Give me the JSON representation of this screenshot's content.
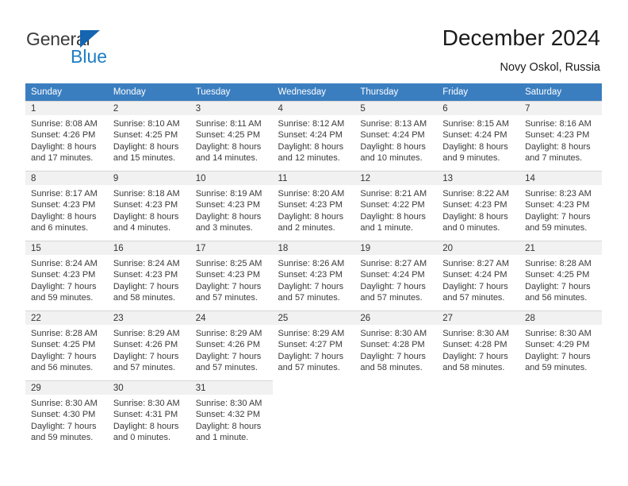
{
  "brand": {
    "name_top": "General",
    "name_bottom": "Blue",
    "triangle_color": "#1565b0",
    "text_color": "#3b3b3b",
    "blue_color": "#1f7ec4"
  },
  "header": {
    "title": "December 2024",
    "location": "Novy Oskol, Russia"
  },
  "theme": {
    "header_row_bg": "#3b7ec0",
    "header_row_text": "#ffffff",
    "daynum_bg": "#f1f1f1",
    "cell_text": "#3a3a3a"
  },
  "weekdays": [
    "Sunday",
    "Monday",
    "Tuesday",
    "Wednesday",
    "Thursday",
    "Friday",
    "Saturday"
  ],
  "weeks": [
    [
      {
        "day": "1",
        "sunrise": "Sunrise: 8:08 AM",
        "sunset": "Sunset: 4:26 PM",
        "daylight1": "Daylight: 8 hours",
        "daylight2": "and 17 minutes."
      },
      {
        "day": "2",
        "sunrise": "Sunrise: 8:10 AM",
        "sunset": "Sunset: 4:25 PM",
        "daylight1": "Daylight: 8 hours",
        "daylight2": "and 15 minutes."
      },
      {
        "day": "3",
        "sunrise": "Sunrise: 8:11 AM",
        "sunset": "Sunset: 4:25 PM",
        "daylight1": "Daylight: 8 hours",
        "daylight2": "and 14 minutes."
      },
      {
        "day": "4",
        "sunrise": "Sunrise: 8:12 AM",
        "sunset": "Sunset: 4:24 PM",
        "daylight1": "Daylight: 8 hours",
        "daylight2": "and 12 minutes."
      },
      {
        "day": "5",
        "sunrise": "Sunrise: 8:13 AM",
        "sunset": "Sunset: 4:24 PM",
        "daylight1": "Daylight: 8 hours",
        "daylight2": "and 10 minutes."
      },
      {
        "day": "6",
        "sunrise": "Sunrise: 8:15 AM",
        "sunset": "Sunset: 4:24 PM",
        "daylight1": "Daylight: 8 hours",
        "daylight2": "and 9 minutes."
      },
      {
        "day": "7",
        "sunrise": "Sunrise: 8:16 AM",
        "sunset": "Sunset: 4:23 PM",
        "daylight1": "Daylight: 8 hours",
        "daylight2": "and 7 minutes."
      }
    ],
    [
      {
        "day": "8",
        "sunrise": "Sunrise: 8:17 AM",
        "sunset": "Sunset: 4:23 PM",
        "daylight1": "Daylight: 8 hours",
        "daylight2": "and 6 minutes."
      },
      {
        "day": "9",
        "sunrise": "Sunrise: 8:18 AM",
        "sunset": "Sunset: 4:23 PM",
        "daylight1": "Daylight: 8 hours",
        "daylight2": "and 4 minutes."
      },
      {
        "day": "10",
        "sunrise": "Sunrise: 8:19 AM",
        "sunset": "Sunset: 4:23 PM",
        "daylight1": "Daylight: 8 hours",
        "daylight2": "and 3 minutes."
      },
      {
        "day": "11",
        "sunrise": "Sunrise: 8:20 AM",
        "sunset": "Sunset: 4:23 PM",
        "daylight1": "Daylight: 8 hours",
        "daylight2": "and 2 minutes."
      },
      {
        "day": "12",
        "sunrise": "Sunrise: 8:21 AM",
        "sunset": "Sunset: 4:22 PM",
        "daylight1": "Daylight: 8 hours",
        "daylight2": "and 1 minute."
      },
      {
        "day": "13",
        "sunrise": "Sunrise: 8:22 AM",
        "sunset": "Sunset: 4:23 PM",
        "daylight1": "Daylight: 8 hours",
        "daylight2": "and 0 minutes."
      },
      {
        "day": "14",
        "sunrise": "Sunrise: 8:23 AM",
        "sunset": "Sunset: 4:23 PM",
        "daylight1": "Daylight: 7 hours",
        "daylight2": "and 59 minutes."
      }
    ],
    [
      {
        "day": "15",
        "sunrise": "Sunrise: 8:24 AM",
        "sunset": "Sunset: 4:23 PM",
        "daylight1": "Daylight: 7 hours",
        "daylight2": "and 59 minutes."
      },
      {
        "day": "16",
        "sunrise": "Sunrise: 8:24 AM",
        "sunset": "Sunset: 4:23 PM",
        "daylight1": "Daylight: 7 hours",
        "daylight2": "and 58 minutes."
      },
      {
        "day": "17",
        "sunrise": "Sunrise: 8:25 AM",
        "sunset": "Sunset: 4:23 PM",
        "daylight1": "Daylight: 7 hours",
        "daylight2": "and 57 minutes."
      },
      {
        "day": "18",
        "sunrise": "Sunrise: 8:26 AM",
        "sunset": "Sunset: 4:23 PM",
        "daylight1": "Daylight: 7 hours",
        "daylight2": "and 57 minutes."
      },
      {
        "day": "19",
        "sunrise": "Sunrise: 8:27 AM",
        "sunset": "Sunset: 4:24 PM",
        "daylight1": "Daylight: 7 hours",
        "daylight2": "and 57 minutes."
      },
      {
        "day": "20",
        "sunrise": "Sunrise: 8:27 AM",
        "sunset": "Sunset: 4:24 PM",
        "daylight1": "Daylight: 7 hours",
        "daylight2": "and 57 minutes."
      },
      {
        "day": "21",
        "sunrise": "Sunrise: 8:28 AM",
        "sunset": "Sunset: 4:25 PM",
        "daylight1": "Daylight: 7 hours",
        "daylight2": "and 56 minutes."
      }
    ],
    [
      {
        "day": "22",
        "sunrise": "Sunrise: 8:28 AM",
        "sunset": "Sunset: 4:25 PM",
        "daylight1": "Daylight: 7 hours",
        "daylight2": "and 56 minutes."
      },
      {
        "day": "23",
        "sunrise": "Sunrise: 8:29 AM",
        "sunset": "Sunset: 4:26 PM",
        "daylight1": "Daylight: 7 hours",
        "daylight2": "and 57 minutes."
      },
      {
        "day": "24",
        "sunrise": "Sunrise: 8:29 AM",
        "sunset": "Sunset: 4:26 PM",
        "daylight1": "Daylight: 7 hours",
        "daylight2": "and 57 minutes."
      },
      {
        "day": "25",
        "sunrise": "Sunrise: 8:29 AM",
        "sunset": "Sunset: 4:27 PM",
        "daylight1": "Daylight: 7 hours",
        "daylight2": "and 57 minutes."
      },
      {
        "day": "26",
        "sunrise": "Sunrise: 8:30 AM",
        "sunset": "Sunset: 4:28 PM",
        "daylight1": "Daylight: 7 hours",
        "daylight2": "and 58 minutes."
      },
      {
        "day": "27",
        "sunrise": "Sunrise: 8:30 AM",
        "sunset": "Sunset: 4:28 PM",
        "daylight1": "Daylight: 7 hours",
        "daylight2": "and 58 minutes."
      },
      {
        "day": "28",
        "sunrise": "Sunrise: 8:30 AM",
        "sunset": "Sunset: 4:29 PM",
        "daylight1": "Daylight: 7 hours",
        "daylight2": "and 59 minutes."
      }
    ],
    [
      {
        "day": "29",
        "sunrise": "Sunrise: 8:30 AM",
        "sunset": "Sunset: 4:30 PM",
        "daylight1": "Daylight: 7 hours",
        "daylight2": "and 59 minutes."
      },
      {
        "day": "30",
        "sunrise": "Sunrise: 8:30 AM",
        "sunset": "Sunset: 4:31 PM",
        "daylight1": "Daylight: 8 hours",
        "daylight2": "and 0 minutes."
      },
      {
        "day": "31",
        "sunrise": "Sunrise: 8:30 AM",
        "sunset": "Sunset: 4:32 PM",
        "daylight1": "Daylight: 8 hours",
        "daylight2": "and 1 minute."
      },
      {
        "day": "",
        "sunrise": "",
        "sunset": "",
        "daylight1": "",
        "daylight2": ""
      },
      {
        "day": "",
        "sunrise": "",
        "sunset": "",
        "daylight1": "",
        "daylight2": ""
      },
      {
        "day": "",
        "sunrise": "",
        "sunset": "",
        "daylight1": "",
        "daylight2": ""
      },
      {
        "day": "",
        "sunrise": "",
        "sunset": "",
        "daylight1": "",
        "daylight2": ""
      }
    ]
  ]
}
